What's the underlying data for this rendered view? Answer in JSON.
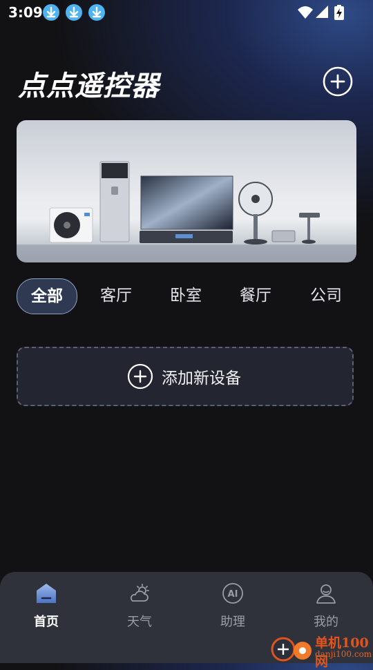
{
  "status_bar": {
    "time": "3:09"
  },
  "header": {
    "title": "点点遥控器"
  },
  "categories": [
    {
      "label": "全部",
      "active": true
    },
    {
      "label": "客厅",
      "active": false
    },
    {
      "label": "卧室",
      "active": false
    },
    {
      "label": "餐厅",
      "active": false
    },
    {
      "label": "公司",
      "active": false
    }
  ],
  "add_device": {
    "label": "添加新设备"
  },
  "bottom_nav": [
    {
      "label": "首页",
      "icon": "home-icon",
      "active": true
    },
    {
      "label": "天气",
      "icon": "weather-icon",
      "active": false
    },
    {
      "label": "助理",
      "icon": "ai-assistant-icon",
      "active": false
    },
    {
      "label": "我的",
      "icon": "profile-icon",
      "active": false
    }
  ],
  "watermark": {
    "name": "单机100网",
    "url": "danji100.com"
  },
  "colors": {
    "accent": "#8ea2c6",
    "background": "#121214",
    "nav_bg": "#30323b",
    "download_badge": "#4fb3f2"
  }
}
